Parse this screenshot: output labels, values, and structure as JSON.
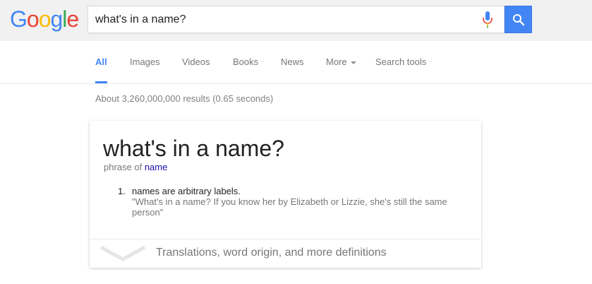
{
  "logo": {
    "letters": [
      "G",
      "o",
      "o",
      "g",
      "l",
      "e"
    ],
    "colors": [
      "#4285f4",
      "#ea4335",
      "#fbbc05",
      "#4285f4",
      "#34a853",
      "#ea4335"
    ]
  },
  "search": {
    "value": "what's in a name?"
  },
  "icons": {
    "mic": "microphone-icon",
    "search": "search-icon",
    "chevron": "chevron-down-icon"
  },
  "tabs": [
    {
      "label": "All"
    },
    {
      "label": "Images"
    },
    {
      "label": "Videos"
    },
    {
      "label": "Books"
    },
    {
      "label": "News"
    },
    {
      "label": "More"
    },
    {
      "label": "Search tools"
    }
  ],
  "stats": "About 3,260,000,000 results (0.65 seconds)",
  "card": {
    "term": "what's in a name?",
    "phrase_prefix": "phrase of",
    "phrase_link": "name",
    "definition_number": "1.",
    "definition": "names are arbitrary labels.",
    "example": "\"What's in a name? If you know her by Elizabeth or Lizzie, she's still the same person\"",
    "more": "Translations, word origin, and more definitions"
  },
  "colors": {
    "accent": "#4285f4",
    "link": "#1a0dab",
    "muted": "#777777"
  }
}
